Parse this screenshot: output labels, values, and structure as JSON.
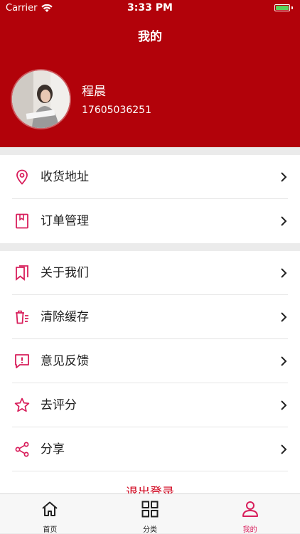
{
  "status_bar": {
    "carrier": "Carrier",
    "time": "3:33 PM"
  },
  "header": {
    "title": "我的",
    "user": {
      "name": "程晨",
      "phone": "17605036251"
    }
  },
  "menu_group_1": [
    {
      "label": "收货地址",
      "icon": "location-pin-icon"
    },
    {
      "label": "订单管理",
      "icon": "order-book-icon"
    }
  ],
  "menu_group_2": [
    {
      "label": "关于我们",
      "icon": "bookmark-icon"
    },
    {
      "label": "清除缓存",
      "icon": "trash-icon"
    },
    {
      "label": "意见反馈",
      "icon": "feedback-icon"
    },
    {
      "label": "去评分",
      "icon": "star-icon"
    },
    {
      "label": "分享",
      "icon": "share-icon"
    }
  ],
  "logout_label": "退出登录",
  "tabs": [
    {
      "label": "首页",
      "icon": "home-icon",
      "active": false
    },
    {
      "label": "分类",
      "icon": "grid-icon",
      "active": false
    },
    {
      "label": "我的",
      "icon": "person-icon",
      "active": true
    }
  ],
  "colors": {
    "header_bg": "#b2020a",
    "icon_accent": "#d81e5b",
    "logout_text": "#d0021b"
  }
}
